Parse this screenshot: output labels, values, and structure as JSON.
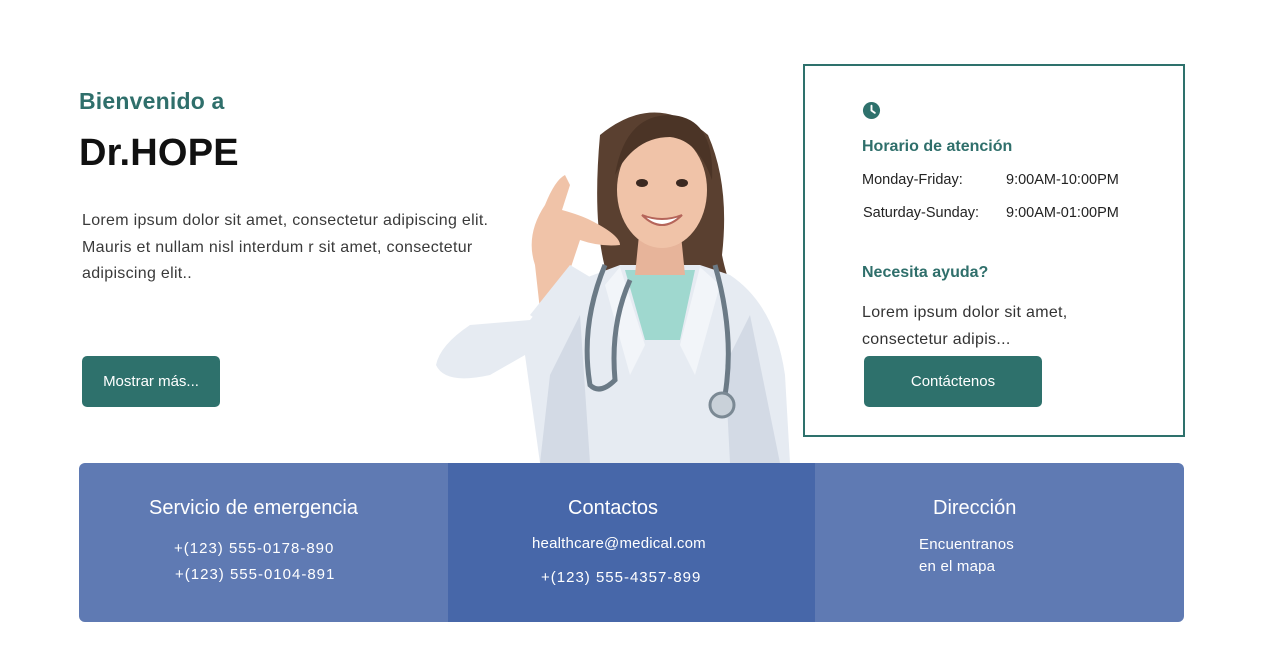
{
  "hero": {
    "welcome": "Bienvenido a",
    "brand": "Dr.HOPE",
    "description": "Lorem ipsum dolor sit amet, consectetur adipiscing elit. Mauris et nullam nisl interdum r sit amet, consectetur adipiscing elit..",
    "more_button": "Mostrar más..."
  },
  "info_card": {
    "hours_title": "Horario de atención",
    "schedule": [
      {
        "days": "Monday-Friday:",
        "time": "9:00AM-10:00PM"
      },
      {
        "days": "Saturday-Sunday:",
        "time": "9:00AM-01:00PM"
      }
    ],
    "help_title": "Necesita ayuda?",
    "help_text": "Lorem ipsum dolor sit amet, consectetur adipis...",
    "contact_button": "Contáctenos"
  },
  "bottom_bar": {
    "emergency": {
      "title": "Servicio de emergencia",
      "phones": [
        "+(123) 555-0178-890",
        "+(123) 555-0104-891"
      ]
    },
    "contacts": {
      "title": "Contactos",
      "email": "healthcare@medical.com",
      "phone": "+(123) 555-4357-899"
    },
    "address": {
      "title": "Dirección",
      "line1": "Encuentranos",
      "line2": "en el mapa"
    }
  },
  "colors": {
    "accent": "#2e716c",
    "bar_light": "#5f7ab3",
    "bar_dark": "#4767a9"
  },
  "icons": {
    "clock": "clock-icon"
  }
}
